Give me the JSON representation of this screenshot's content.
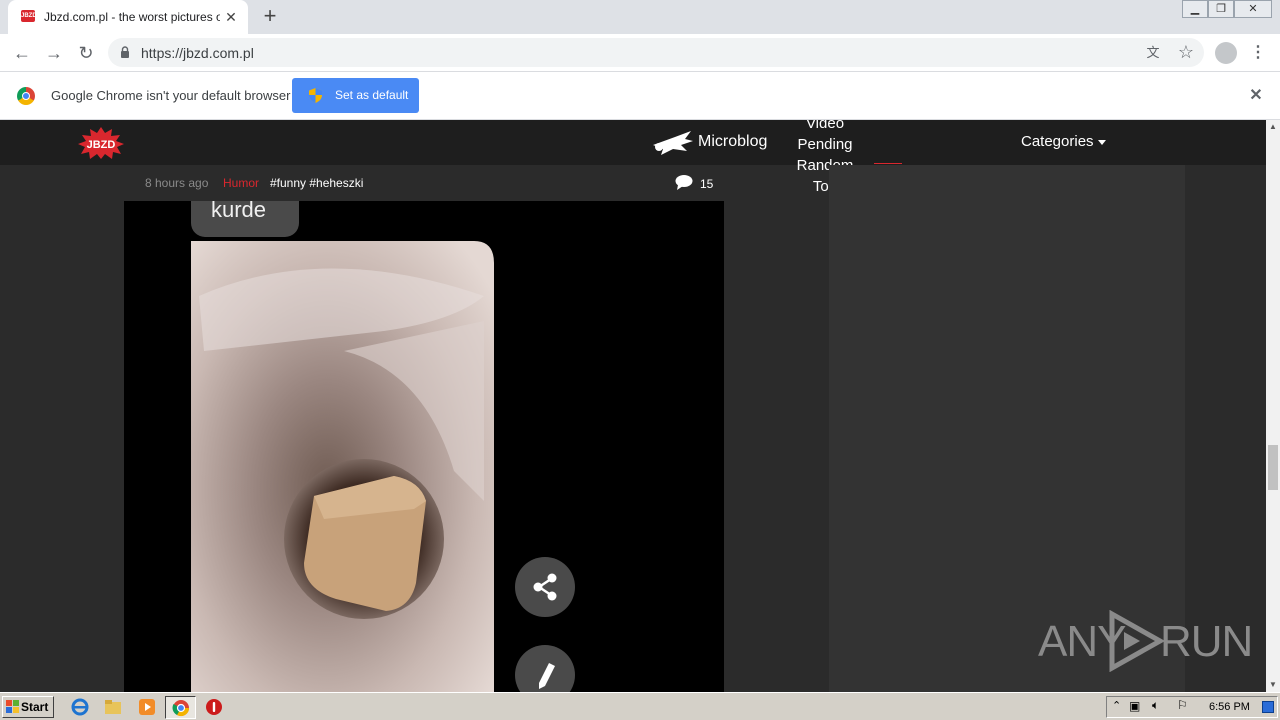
{
  "browser": {
    "tab_title": "Jbzd.com.pl - the worst pictures on t",
    "url": "https://jbzd.com.pl",
    "favicon_text": "JBZD"
  },
  "infobar": {
    "message": "Google Chrome isn't your default browser",
    "button_label": "Set as default"
  },
  "site": {
    "logo_text": "JBZD",
    "nav": {
      "microblog": "Microblog",
      "stack": [
        "Video",
        "Pending",
        "Random",
        "Top"
      ],
      "categories": "Categories"
    }
  },
  "post": {
    "time": "8 hours ago",
    "category": "Humor",
    "tags": "#funny #heheszki",
    "comments": "15",
    "image_caption": "kurde"
  },
  "watermark": {
    "left": "ANY",
    "right": "RUN"
  },
  "taskbar": {
    "start_label": "Start",
    "clock": "6:56 PM"
  },
  "colors": {
    "accent_red": "#d9272e",
    "chrome_blue": "#4a8af4",
    "page_bg": "#2b2b2b",
    "nav_bg": "#1e1e1e"
  }
}
